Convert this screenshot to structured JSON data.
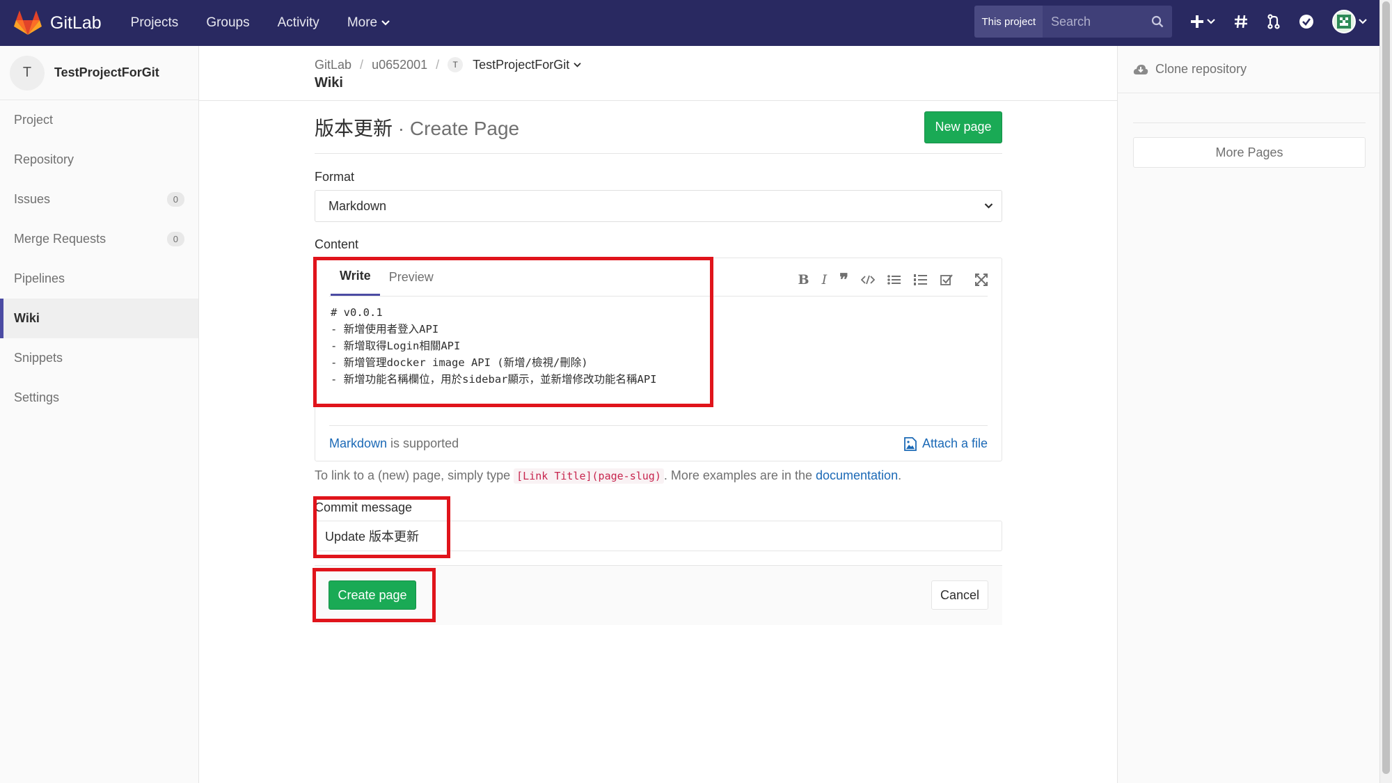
{
  "navbar": {
    "brand": "GitLab",
    "links": [
      {
        "label": "Projects"
      },
      {
        "label": "Groups"
      },
      {
        "label": "Activity"
      },
      {
        "label": "More"
      }
    ],
    "search_scope": "This project",
    "search_placeholder": "Search"
  },
  "sidebar": {
    "project_initial": "T",
    "project_name": "TestProjectForGit",
    "items": [
      {
        "label": "Project",
        "badge": null
      },
      {
        "label": "Repository",
        "badge": null
      },
      {
        "label": "Issues",
        "badge": "0"
      },
      {
        "label": "Merge Requests",
        "badge": "0"
      },
      {
        "label": "Pipelines",
        "badge": null
      },
      {
        "label": "Wiki",
        "badge": null,
        "active": true
      },
      {
        "label": "Snippets",
        "badge": null
      },
      {
        "label": "Settings",
        "badge": null
      }
    ]
  },
  "breadcrumb": {
    "items": [
      "GitLab",
      "u0652001"
    ],
    "project_initial": "T",
    "project": "TestProjectForGit",
    "title": "Wiki"
  },
  "page": {
    "title": "版本更新",
    "subtitle": "· Create Page",
    "new_page_button": "New page",
    "format_label": "Format",
    "format_value": "Markdown",
    "content_label": "Content",
    "tabs": {
      "write": "Write",
      "preview": "Preview"
    },
    "content_lines": [
      "# v0.0.1",
      "- 新增使用者登入API",
      "- 新增取得Login相關API",
      "- 新增管理docker image API (新增/檢視/刪除)",
      "- 新增功能名稱欄位，用於sidebar顯示，並新增修改功能名稱API"
    ],
    "markdown_link": "Markdown",
    "supported_text": "is supported",
    "attach_file": "Attach a file",
    "hint_prefix": "To link to a (new) page, simply type",
    "hint_code": "[Link Title](page-slug)",
    "hint_middle": ". More examples are in the",
    "hint_link": "documentation",
    "hint_suffix": ".",
    "commit_label": "Commit message",
    "commit_value": "Update 版本更新",
    "create_button": "Create page",
    "cancel_button": "Cancel"
  },
  "right_sidebar": {
    "clone": "Clone repository",
    "more_pages": "More Pages"
  },
  "colors": {
    "navbar": "#292961",
    "green": "#1aaa55",
    "annotation_red": "#e0141b",
    "link": "#1b69b6"
  }
}
